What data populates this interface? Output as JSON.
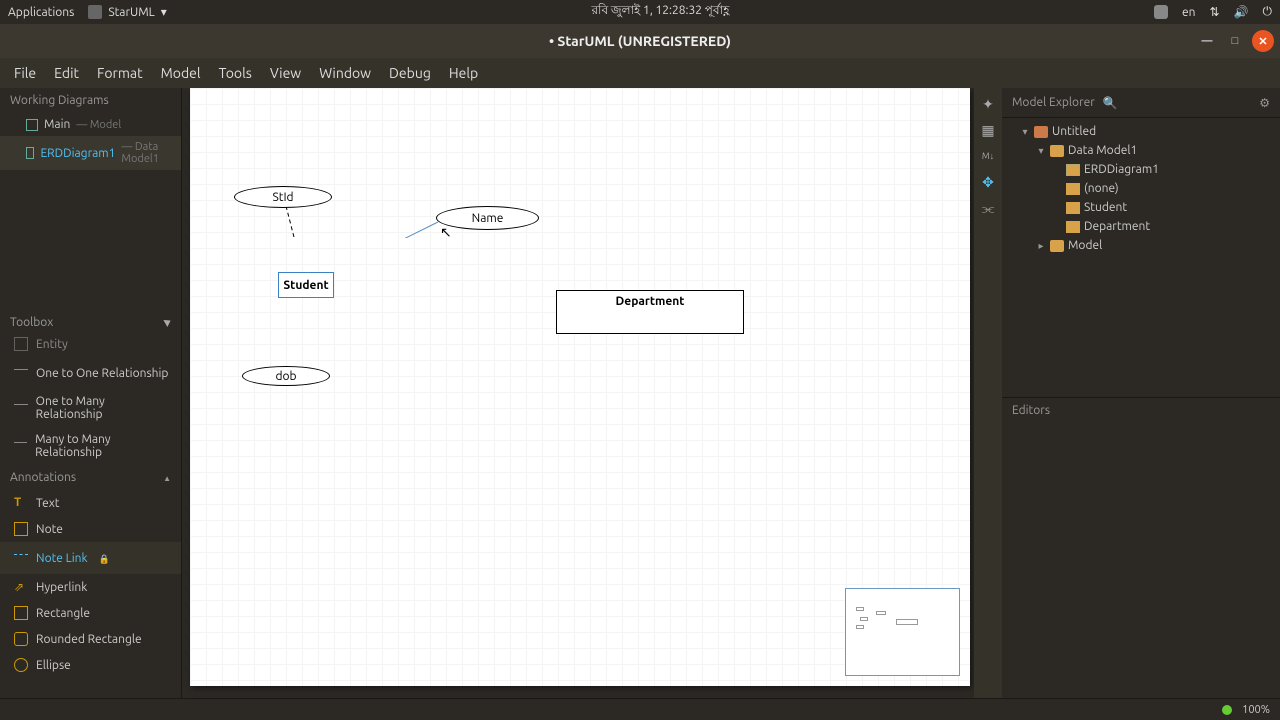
{
  "system_bar": {
    "applications": "Applications",
    "app_name": "StarUML",
    "datetime": "রবি জুলাই   1, 12:28:32 পূর্বাহ্ণ",
    "lang": "en"
  },
  "title_bar": {
    "title": "• StarUML (UNREGISTERED)"
  },
  "menu": {
    "file": "File",
    "edit": "Edit",
    "format": "Format",
    "model": "Model",
    "tools": "Tools",
    "view": "View",
    "window": "Window",
    "debug": "Debug",
    "help": "Help"
  },
  "working_diagrams": {
    "header": "Working Diagrams",
    "items": [
      {
        "label": "Main",
        "sub": "— Model"
      },
      {
        "label": "ERDDiagram1",
        "sub": "— Data Model1"
      }
    ]
  },
  "toolbox": {
    "header": "Toolbox",
    "items_top": [
      "Entity",
      "One to One Relationship",
      "One to Many Relationship",
      "Many to Many Relationship"
    ],
    "annotations_header": "Annotations",
    "items_ann": [
      "Text",
      "Note",
      "Note Link",
      "Hyperlink",
      "Rectangle",
      "Rounded Rectangle",
      "Ellipse"
    ]
  },
  "canvas": {
    "nodes": {
      "stid": "StId",
      "name": "Name",
      "dob": "dob",
      "student": "Student",
      "department": "Department"
    }
  },
  "explorer": {
    "header": "Model Explorer",
    "search_placeholder": "",
    "tree": {
      "root": "Untitled",
      "model1": "Data Model1",
      "diagram": "ERDDiagram1",
      "none": "(none)",
      "student": "Student",
      "department": "Department",
      "model": "Model"
    }
  },
  "editors": {
    "header": "Editors"
  },
  "status": {
    "zoom": "100%"
  }
}
